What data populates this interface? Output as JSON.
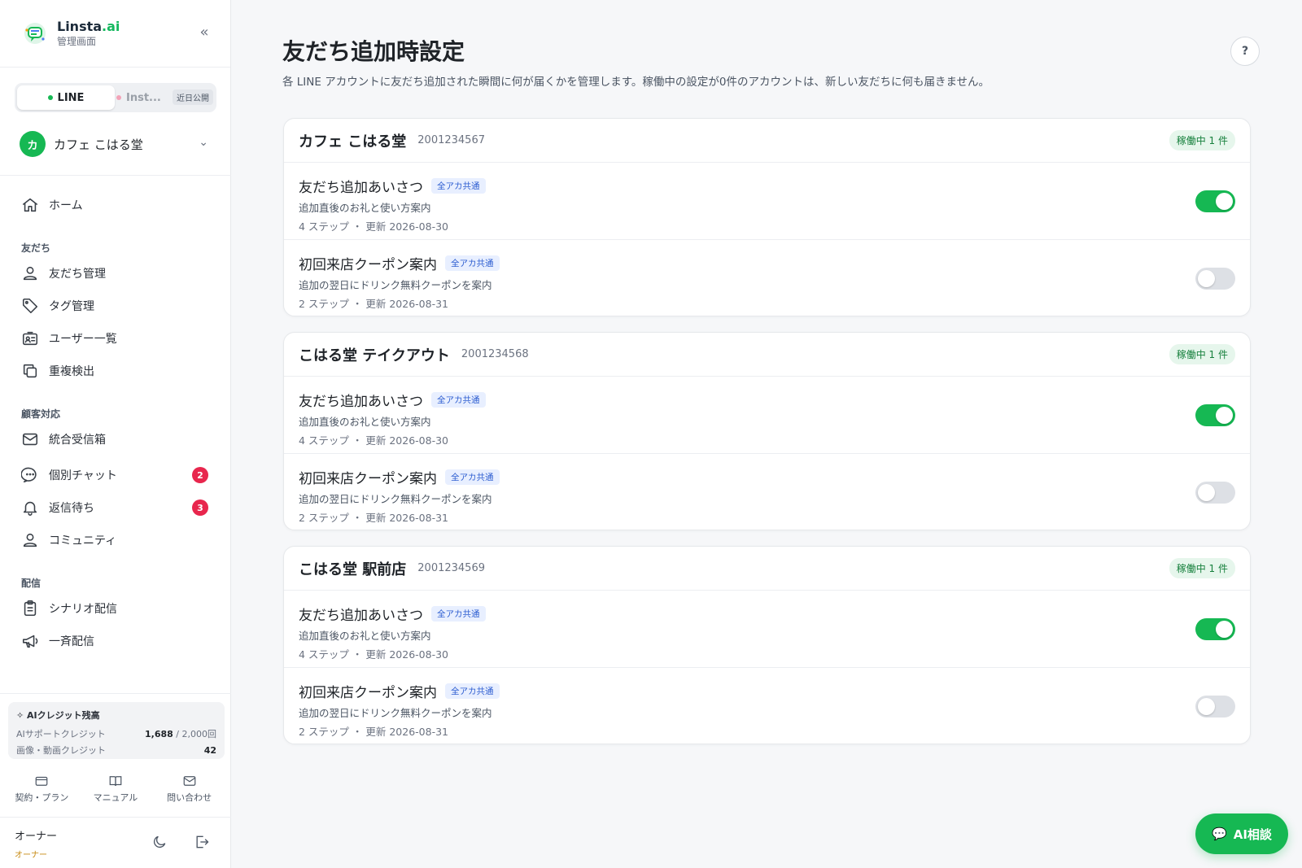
{
  "brand": {
    "name": "Linsta",
    "suffix": ".ai",
    "sub": "管理画面"
  },
  "channels": {
    "line": "LINE",
    "inst": "Inst...",
    "soon": "近日公開"
  },
  "account": {
    "avatar": "カ",
    "name": "カフェ こはる堂"
  },
  "nav": {
    "home": "ホーム",
    "section_friends": "友だち",
    "friends": "友だち管理",
    "tags": "タグ管理",
    "users": "ユーザー一覧",
    "dup": "重複検出",
    "section_support": "顧客対応",
    "inbox": "統合受信箱",
    "chat": "個別チャット",
    "chat_badge": "2",
    "waiting": "返信待ち",
    "waiting_badge": "3",
    "community": "コミュニティ",
    "section_delivery": "配信",
    "scenario": "シナリオ配信",
    "broadcast": "一斉配信"
  },
  "credits": {
    "title": "AIクレジット残高",
    "support_label": "AIサポートクレジット",
    "support_value": "1,688",
    "support_total": "/ 2,000回",
    "media_label": "画像・動画クレジット",
    "media_value": "42"
  },
  "links": {
    "plan": "契約・プラン",
    "manual": "マニュアル",
    "contact": "問い合わせ"
  },
  "owner": {
    "name": "オーナー",
    "role": "オーナー"
  },
  "page": {
    "title": "友だち追加時設定",
    "subtitle": "各 LINE アカウントに友だち追加された瞬間に何が届くかを管理します。稼働中の設定が0件のアカウントは、新しい友だちに何も届きません。",
    "help": "?"
  },
  "accounts": [
    {
      "name": "カフェ こはる堂",
      "id": "2001234567",
      "status": "稼働中 1 件",
      "rows": [
        {
          "title": "友だち追加あいさつ",
          "tag": "全アカ共通",
          "desc": "追加直後のお礼と使い方案内",
          "meta": "4 ステップ ・ 更新 2026-08-30",
          "enabled": true
        },
        {
          "title": "初回来店クーポン案内",
          "tag": "全アカ共通",
          "desc": "追加の翌日にドリンク無料クーポンを案内",
          "meta": "2 ステップ ・ 更新 2026-08-31",
          "enabled": false
        }
      ]
    },
    {
      "name": "こはる堂 テイクアウト",
      "id": "2001234568",
      "status": "稼働中 1 件",
      "rows": [
        {
          "title": "友だち追加あいさつ",
          "tag": "全アカ共通",
          "desc": "追加直後のお礼と使い方案内",
          "meta": "4 ステップ ・ 更新 2026-08-30",
          "enabled": true
        },
        {
          "title": "初回来店クーポン案内",
          "tag": "全アカ共通",
          "desc": "追加の翌日にドリンク無料クーポンを案内",
          "meta": "2 ステップ ・ 更新 2026-08-31",
          "enabled": false
        }
      ]
    },
    {
      "name": "こはる堂 駅前店",
      "id": "2001234569",
      "status": "稼働中 1 件",
      "rows": [
        {
          "title": "友だち追加あいさつ",
          "tag": "全アカ共通",
          "desc": "追加直後のお礼と使い方案内",
          "meta": "4 ステップ ・ 更新 2026-08-30",
          "enabled": true
        },
        {
          "title": "初回来店クーポン案内",
          "tag": "全アカ共通",
          "desc": "追加の翌日にドリンク無料クーポンを案内",
          "meta": "2 ステップ ・ 更新 2026-08-31",
          "enabled": false
        }
      ]
    }
  ],
  "ai_button": "AI相談",
  "colors": {
    "accent": "#16b853",
    "badge": "#e8264d",
    "tag_text": "#2f5fd1"
  }
}
